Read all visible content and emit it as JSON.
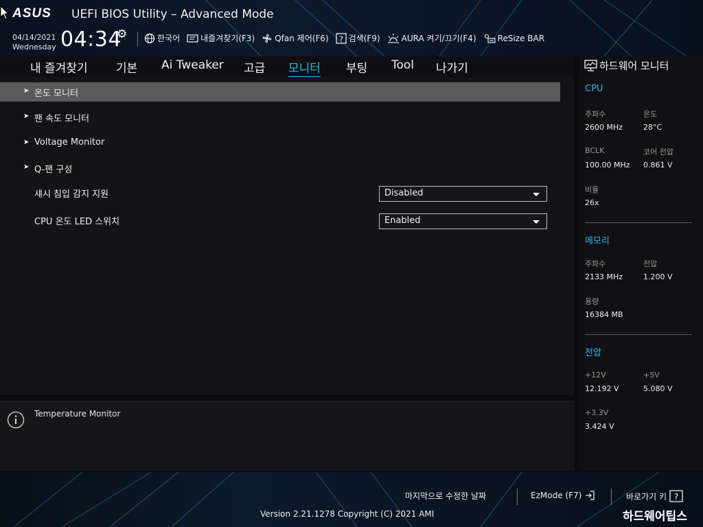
{
  "header": {
    "brand": "ASUS",
    "title": "UEFI BIOS Utility – Advanced Mode",
    "date": "04/14/2021",
    "weekday": "Wednesday",
    "time": "04:34",
    "toolbar": [
      {
        "icon": "globe-icon",
        "label": "한국어"
      },
      {
        "icon": "favorites-icon",
        "label": "내즐겨찾기(F3)"
      },
      {
        "icon": "fan-icon",
        "label": "Qfan 제어(F6)"
      },
      {
        "icon": "help-search-icon",
        "label": "검색(F9)"
      },
      {
        "icon": "aura-icon",
        "label": "AURA 켜기/끄기(F4)"
      },
      {
        "icon": "resize-bar-icon",
        "label": "ReSize BAR"
      }
    ]
  },
  "tabs": [
    {
      "label": "내 즐겨찾기"
    },
    {
      "label": "기본"
    },
    {
      "label": "Ai Tweaker"
    },
    {
      "label": "고급"
    },
    {
      "label": "모니터",
      "active": true
    },
    {
      "label": "부팅"
    },
    {
      "label": "Tool"
    },
    {
      "label": "나가기"
    }
  ],
  "menu": [
    {
      "label": "온도 모니터",
      "submenu": true,
      "selected": true
    },
    {
      "label": "팬 속도 모니터",
      "submenu": true
    },
    {
      "label": "Voltage Monitor",
      "submenu": true
    },
    {
      "label": "Q-팬 구성",
      "submenu": true
    },
    {
      "label": "섀시 침입 감지 지원",
      "value": "Disabled"
    },
    {
      "label": "CPU 온도 LED 스위치",
      "value": "Enabled"
    }
  ],
  "help": {
    "text": "Temperature Monitor"
  },
  "hw_monitor": {
    "title": "하드웨어 모니터",
    "cpu": {
      "heading": "CPU",
      "freq_label": "주파수",
      "freq": "2600 MHz",
      "temp_label": "온도",
      "temp": "28°C",
      "bclk_label": "BCLK",
      "bclk": "100.00 MHz",
      "core_v_label": "코어 전압",
      "core_v": "0.861 V",
      "ratio_label": "비율",
      "ratio": "26x"
    },
    "memory": {
      "heading": "메모리",
      "freq_label": "주파수",
      "freq": "2133 MHz",
      "volt_label": "전압",
      "volt": "1.200 V",
      "cap_label": "용량",
      "cap": "16384 MB"
    },
    "voltage": {
      "heading": "전압",
      "v12_label": "+12V",
      "v12": "12.192 V",
      "v5_label": "+5V",
      "v5": "5.080 V",
      "v33_label": "+3.3V",
      "v33": "3.424 V"
    }
  },
  "footer": {
    "last_modified": "마지막으로 수정한 날짜",
    "ezmode": "EzMode (F7)",
    "hotkeys": "바로가기 키",
    "version": "Version 2.21.1278 Copyright (C) 2021 AMI"
  },
  "watermark": "하드웨어팁스",
  "colors": {
    "accent": "#2fb7e8",
    "selected_row": "#5a5a5a",
    "panel": "#141416",
    "sidebar": "#111113"
  }
}
